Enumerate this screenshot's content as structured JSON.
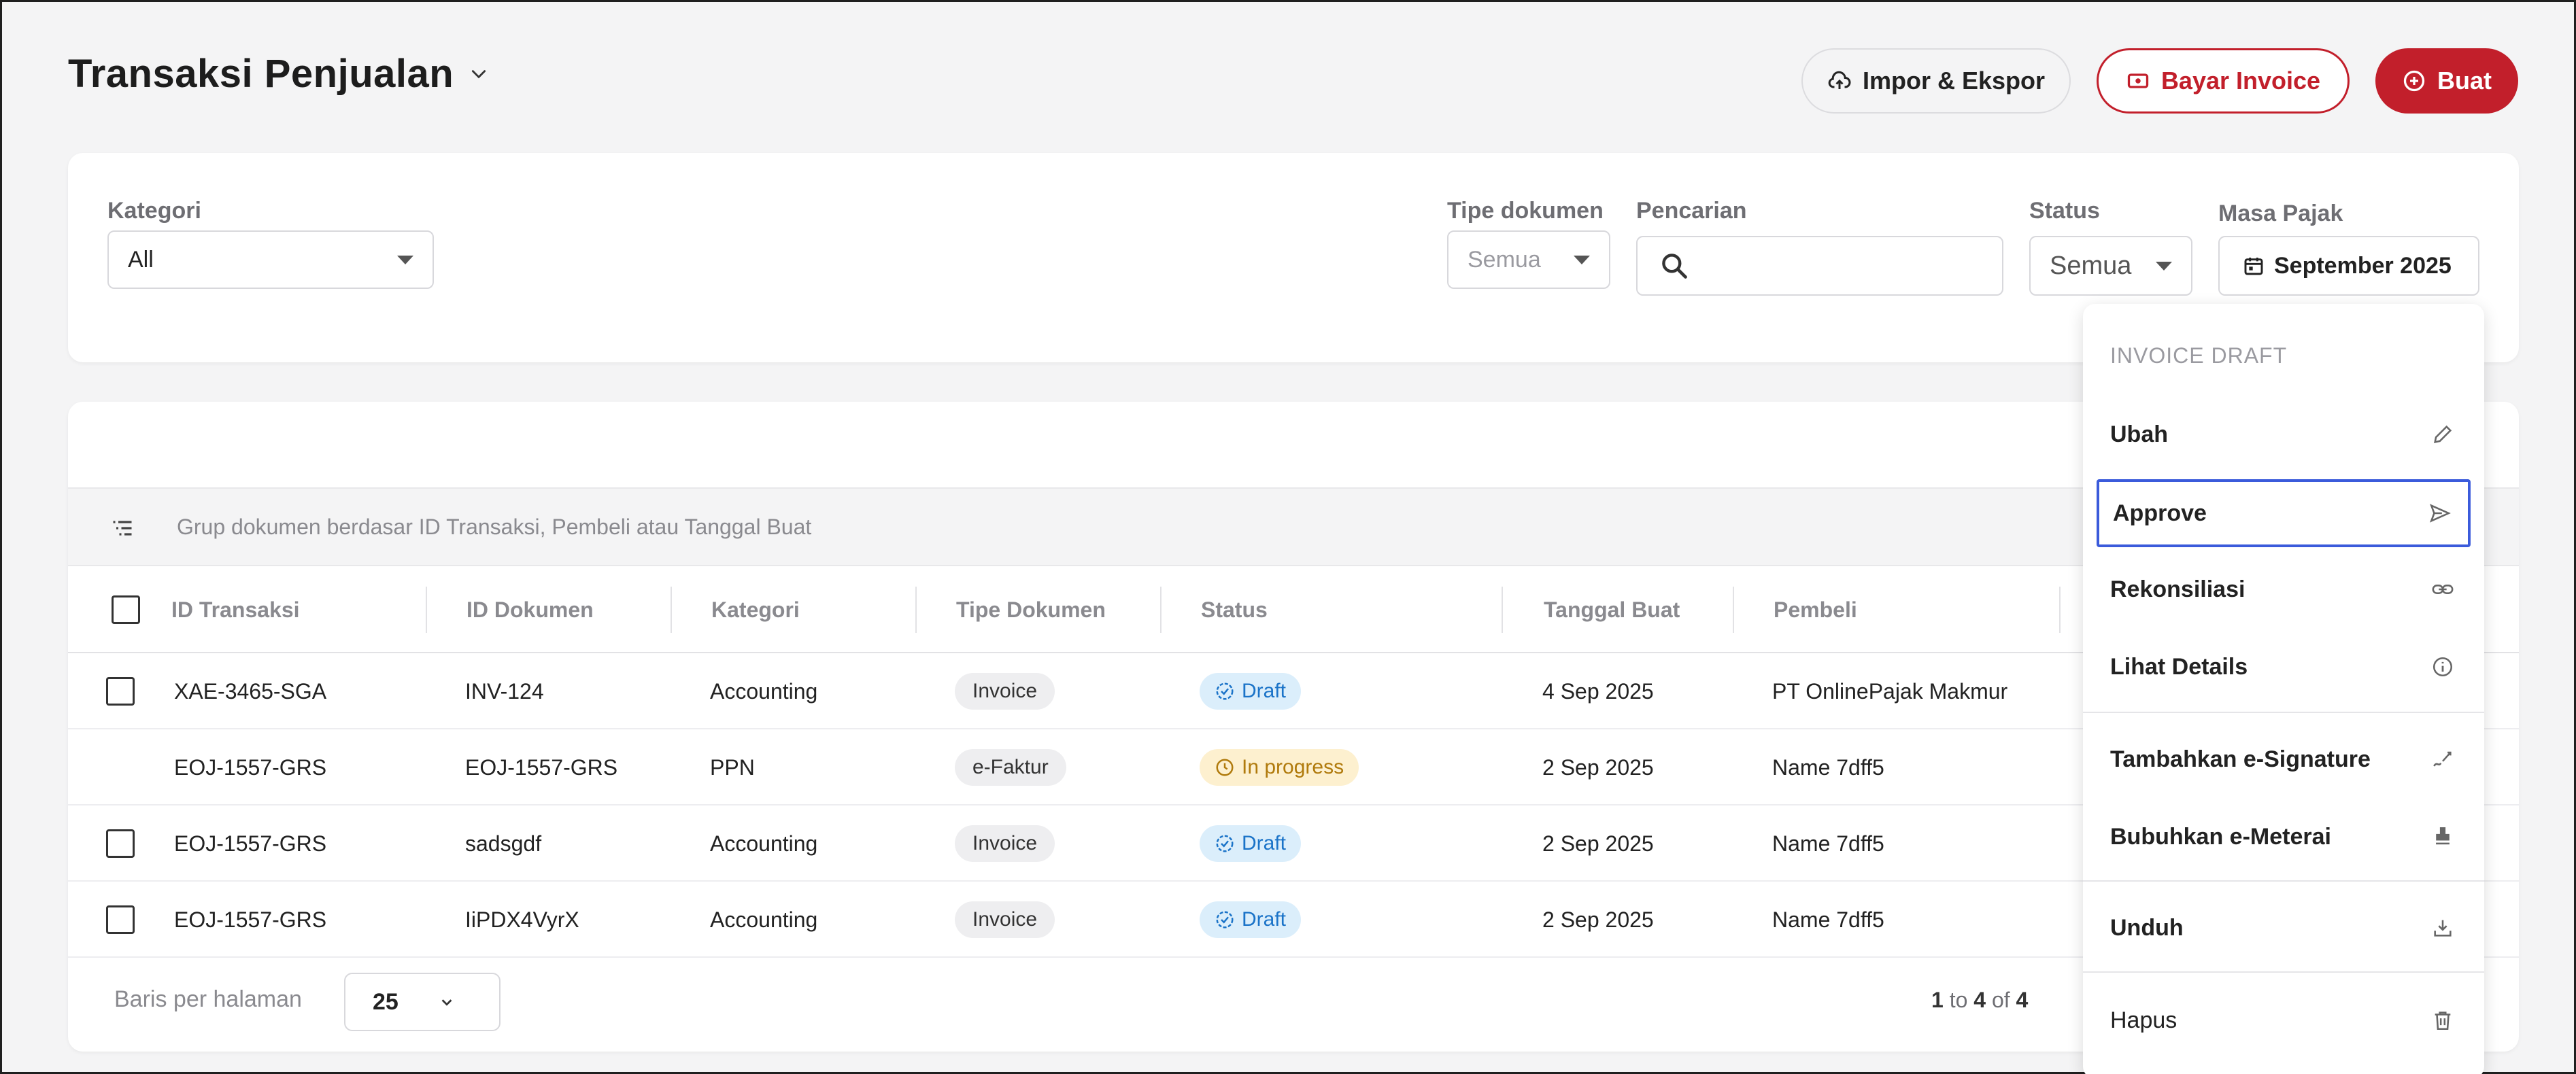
{
  "header": {
    "title": "Transaksi Penjualan",
    "impor_label": "Impor & Ekspor",
    "bayar_label": "Bayar Invoice",
    "buat_label": "Buat"
  },
  "filters": {
    "kategori_label": "Kategori",
    "kategori_value": "All",
    "tipe_label": "Tipe dokumen",
    "tipe_value": "Semua",
    "pencarian_label": "Pencarian",
    "status_label": "Status",
    "status_value": "Semua",
    "masa_label": "Masa Pajak",
    "masa_value": "September 2025"
  },
  "table": {
    "group_text": "Grup dokumen berdasar ID Transaksi, Pembeli atau Tanggal Buat",
    "columns": [
      "ID Transaksi",
      "ID Dokumen",
      "Kategori",
      "Tipe Dokumen",
      "Status",
      "Tanggal Buat",
      "Pembeli"
    ],
    "rows": [
      {
        "id_transaksi": "XAE-3465-SGA",
        "id_dokumen": "INV-124",
        "kategori": "Accounting",
        "tipe": "Invoice",
        "status": "Draft",
        "tanggal": "4 Sep 2025",
        "pembeli": "PT OnlinePajak Makmur"
      },
      {
        "id_transaksi": "EOJ-1557-GRS",
        "id_dokumen": "EOJ-1557-GRS",
        "kategori": "PPN",
        "tipe": "e-Faktur",
        "status": "In progress",
        "tanggal": "2 Sep 2025",
        "pembeli": "Name 7dff5"
      },
      {
        "id_transaksi": "EOJ-1557-GRS",
        "id_dokumen": "sadsgdf",
        "kategori": "Accounting",
        "tipe": "Invoice",
        "status": "Draft",
        "tanggal": "2 Sep 2025",
        "pembeli": "Name 7dff5"
      },
      {
        "id_transaksi": "EOJ-1557-GRS",
        "id_dokumen": "IiPDX4VyrX",
        "kategori": "Accounting",
        "tipe": "Invoice",
        "status": "Draft",
        "tanggal": "2 Sep 2025",
        "pembeli": "Name 7dff5"
      }
    ]
  },
  "footer": {
    "rows_label": "Baris per halaman",
    "rows_value": "25",
    "page_from": "1",
    "page_to": "4",
    "page_total": "4",
    "to_word": "to",
    "of_word": "of"
  },
  "menu": {
    "header": "INVOICE DRAFT",
    "items": [
      {
        "label": "Ubah",
        "icon": "pencil-icon"
      },
      {
        "label": "Approve",
        "icon": "send-icon"
      },
      {
        "label": "Rekonsiliasi",
        "icon": "link-icon"
      },
      {
        "label": "Lihat Details",
        "icon": "info-icon"
      },
      {
        "label": "Tambahkan e-Signature",
        "icon": "signature-icon"
      },
      {
        "label": "Bubuhkan e-Meterai",
        "icon": "stamp-icon"
      },
      {
        "label": "Unduh",
        "icon": "download-icon"
      },
      {
        "label": "Hapus",
        "icon": "trash-icon"
      }
    ]
  },
  "colors": {
    "brand_red": "#c21f2b",
    "draft_blue": "#1a73c8",
    "progress_amber": "#b07a0c",
    "selection_blue": "#3b5bdb"
  }
}
